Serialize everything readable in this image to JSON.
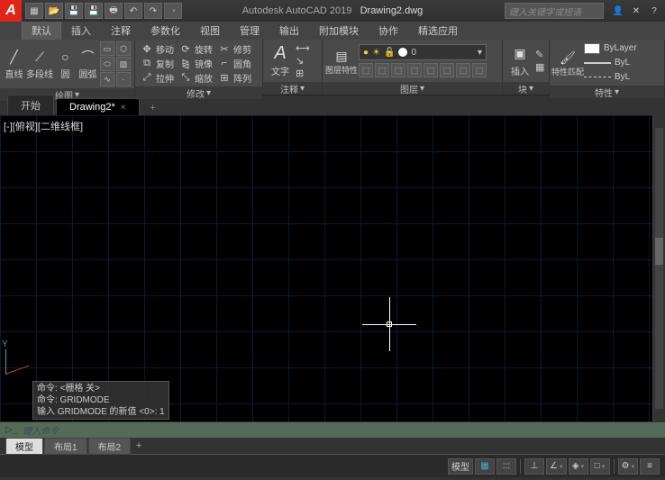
{
  "title": {
    "app": "Autodesk AutoCAD 2019",
    "file": "Drawing2.dwg"
  },
  "search_placeholder": "键入关键字或短语",
  "menutabs": [
    "默认",
    "插入",
    "注释",
    "参数化",
    "视图",
    "管理",
    "输出",
    "附加模块",
    "协作",
    "精选应用"
  ],
  "ribbon": {
    "draw": {
      "title": "绘图",
      "line": "直线",
      "polyline": "多段线",
      "circle": "圆",
      "arc": "圆弧"
    },
    "modify": {
      "title": "修改",
      "move": "移动",
      "rotate": "旋转",
      "trim": "修剪",
      "copy": "复制",
      "mirror": "镜像",
      "fillet": "圆角",
      "stretch": "拉伸",
      "scale": "缩放",
      "array": "阵列"
    },
    "annotate": {
      "title": "注释",
      "text": "文字"
    },
    "layers": {
      "title": "图层",
      "props": "图层特性",
      "current": "0"
    },
    "block": {
      "title": "块",
      "insert": "插入"
    },
    "props": {
      "title": "特性",
      "match": "特性匹配",
      "bylayer": "ByLayer",
      "byl": "ByL"
    }
  },
  "filetabs": {
    "start": "开始",
    "drawing": "Drawing2*"
  },
  "viewlabel": "[-][俯视][二维线框]",
  "ucs_y": "Y",
  "cmd": {
    "l1": "命令: <栅格 关>",
    "l2": "命令: GRIDMODE",
    "l3": "输入 GRIDMODE 的新值 <0>: 1",
    "hint": "键入命令",
    "prompt": "▷_"
  },
  "layouts": {
    "model": "模型",
    "layout1": "布局1",
    "layout2": "布局2"
  },
  "status": {
    "model": "模型"
  }
}
